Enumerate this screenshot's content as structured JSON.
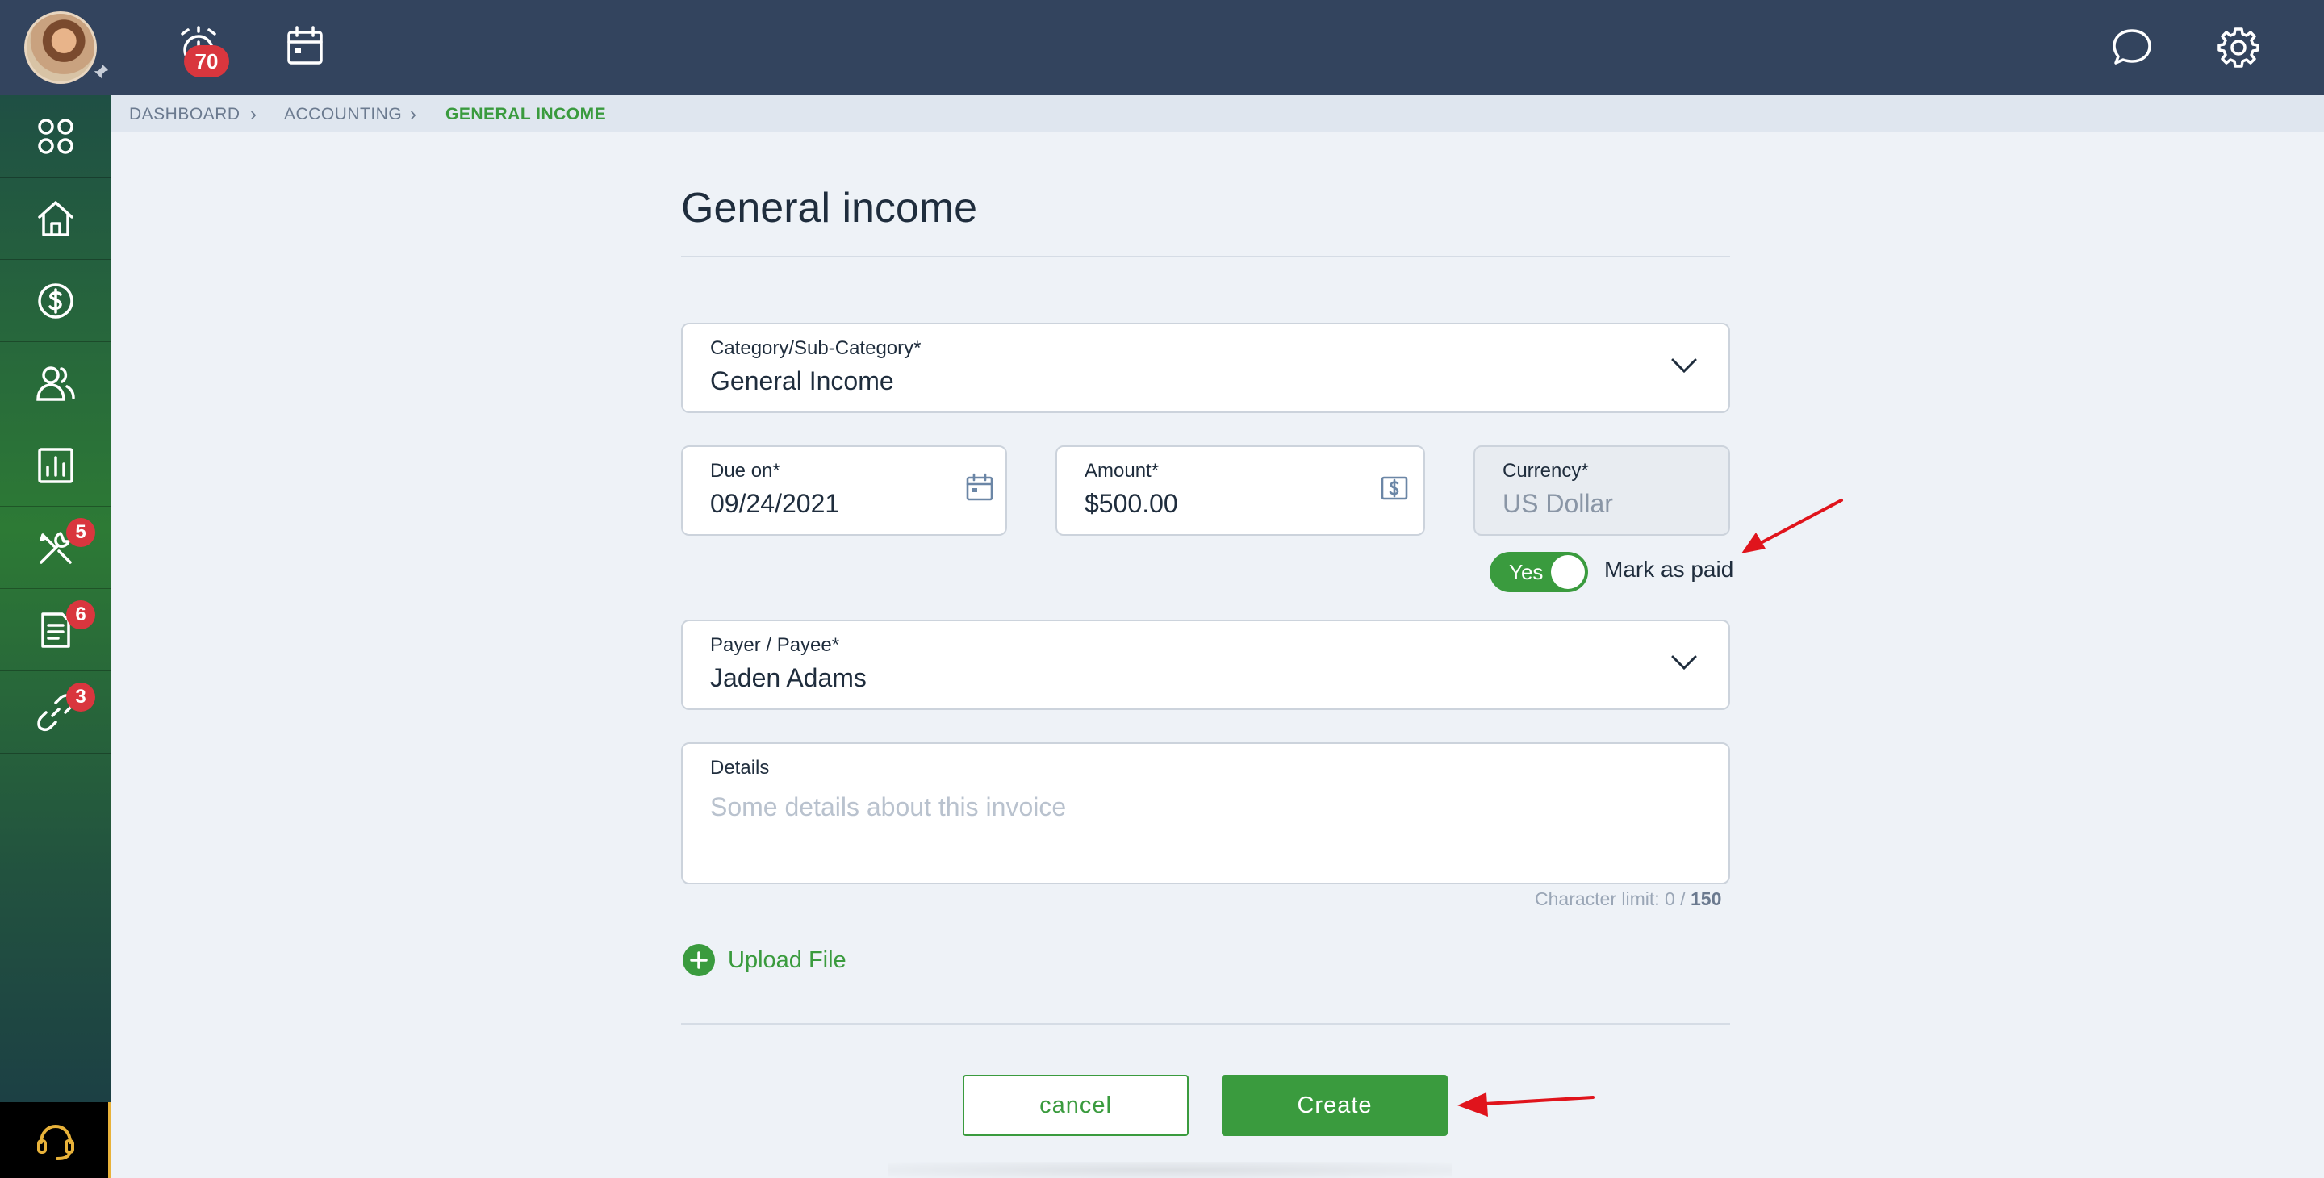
{
  "topbar": {
    "alarm_badge": "70",
    "icons": [
      "alarm-icon",
      "calendar-icon",
      "chat-icon",
      "gear-icon"
    ]
  },
  "sidebar": {
    "items": [
      {
        "icon": "apps-grid-icon"
      },
      {
        "icon": "home-icon"
      },
      {
        "icon": "dollar-icon"
      },
      {
        "icon": "users-icon"
      },
      {
        "icon": "report-chart-icon"
      },
      {
        "icon": "tools-icon",
        "badge": "5"
      },
      {
        "icon": "document-icon",
        "badge": "6"
      },
      {
        "icon": "link-icon",
        "badge": "3"
      }
    ],
    "support_icon": "headset-icon"
  },
  "breadcrumb": {
    "items": [
      "DASHBOARD",
      "ACCOUNTING",
      "GENERAL INCOME"
    ]
  },
  "form": {
    "title": "General income",
    "category": {
      "label": "Category/Sub-Category*",
      "value": "General Income"
    },
    "due_on": {
      "label": "Due on*",
      "value": "09/24/2021"
    },
    "amount": {
      "label": "Amount*",
      "value": "$500.00"
    },
    "currency": {
      "label": "Currency*",
      "value": "US Dollar"
    },
    "mark_paid": {
      "toggle_text": "Yes",
      "label": "Mark as paid",
      "on": true
    },
    "payer": {
      "label": "Payer / Payee*",
      "value": "Jaden Adams"
    },
    "details": {
      "label": "Details",
      "placeholder": "Some details about this invoice",
      "value": ""
    },
    "char_limit": {
      "prefix": "Character limit: 0 / ",
      "max": "150"
    },
    "upload_label": "Upload File",
    "cancel_label": "cancel",
    "create_label": "Create"
  },
  "colors": {
    "accent": "#3a9b3e",
    "topbar": "#33445e",
    "badge": "#d9363e",
    "annotation_arrow": "#e0141c"
  }
}
